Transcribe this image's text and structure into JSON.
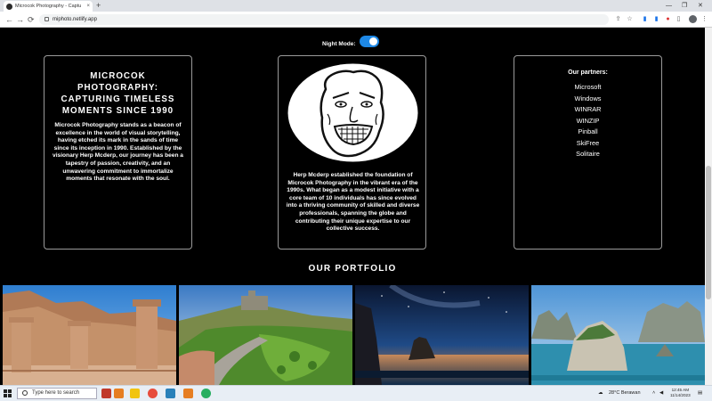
{
  "browser": {
    "tab_title": "Microcok Photography - Captu",
    "tab_close": "×",
    "new_tab": "+",
    "url": "miphoto.netlify.app",
    "back": "←",
    "forward": "→",
    "reload": "⟳",
    "window_min": "—",
    "window_max": "❐",
    "window_close": "✕"
  },
  "page": {
    "night_mode_label": "Night Mode:",
    "night_mode_on": true,
    "card1": {
      "heading": "MICROCOK PHOTOGRAPHY: CAPTURING TIMELESS MOMENTS SINCE 1990",
      "body": "Microcok Photography stands as a beacon of excellence in the world of visual storytelling, having etched its mark in the sands of time since its inception in 1990. Established by the visionary Herp Mcderp, our journey has been a tapestry of passion, creativity, and an unwavering commitment to immortalize moments that resonate with the soul."
    },
    "card2": {
      "body": "Herp Mcderp established the foundation of Microcok Photography in the vibrant era of the 1990s. What began as a modest initiative with a core team of 10 individuals has since evolved into a thriving community of skilled and diverse professionals, spanning the globe and contributing their unique expertise to our collective success."
    },
    "partners": {
      "heading": "Our partners:",
      "items": [
        "Microsoft",
        "Windows",
        "WINRAR",
        "WINZIP",
        "Pinball",
        "SkiFree",
        "Solitaire"
      ]
    },
    "portfolio_title": "OUR PORTFOLIO"
  },
  "taskbar": {
    "search_placeholder": "Type here to search",
    "weather": "28°C  Berawan",
    "time": "12:45 AM",
    "date": "11/14/2023"
  },
  "colors": {
    "toggle_accent": "#1e88e5",
    "page_bg": "#000000"
  }
}
